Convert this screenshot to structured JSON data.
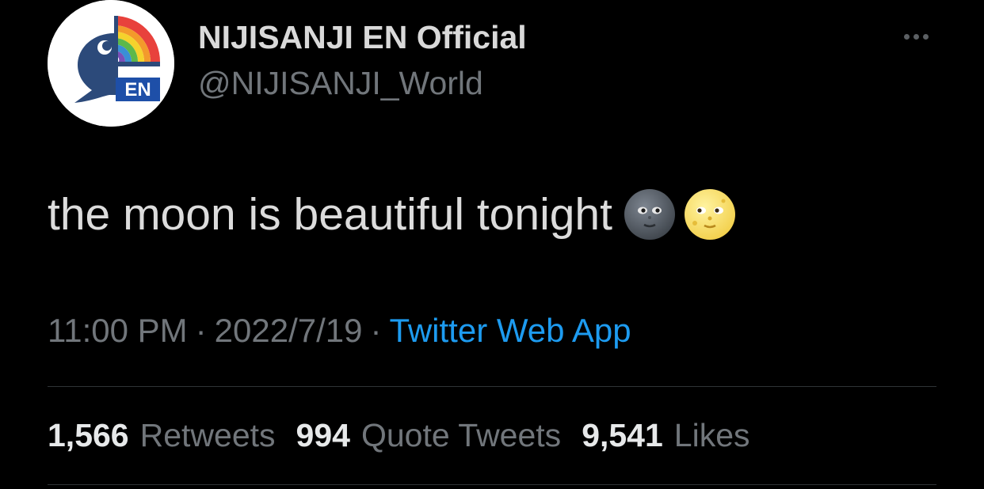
{
  "author": {
    "display_name": "NIJISANJI EN Official",
    "handle": "@NIJISANJI_World",
    "avatar_badge": "EN",
    "avatar_icon": "nijisanji-rainbow-bubble-logo"
  },
  "tweet": {
    "text": "the moon is beautiful tonight",
    "emoji": [
      "new-moon-face-emoji",
      "full-moon-face-emoji"
    ],
    "time": "11:00 PM",
    "date": "2022/7/19",
    "separator": "·",
    "source": "Twitter Web App"
  },
  "stats": {
    "retweets": {
      "count": "1,566",
      "label": "Retweets"
    },
    "quotes": {
      "count": "994",
      "label": "Quote Tweets"
    },
    "likes": {
      "count": "9,541",
      "label": "Likes"
    }
  },
  "menu": {
    "icon": "more-horizontal-icon"
  },
  "colors": {
    "background": "#000000",
    "text": "#d9d9d9",
    "secondary_text": "#71767b",
    "link": "#1d9bf0",
    "divider": "#2f3336"
  }
}
